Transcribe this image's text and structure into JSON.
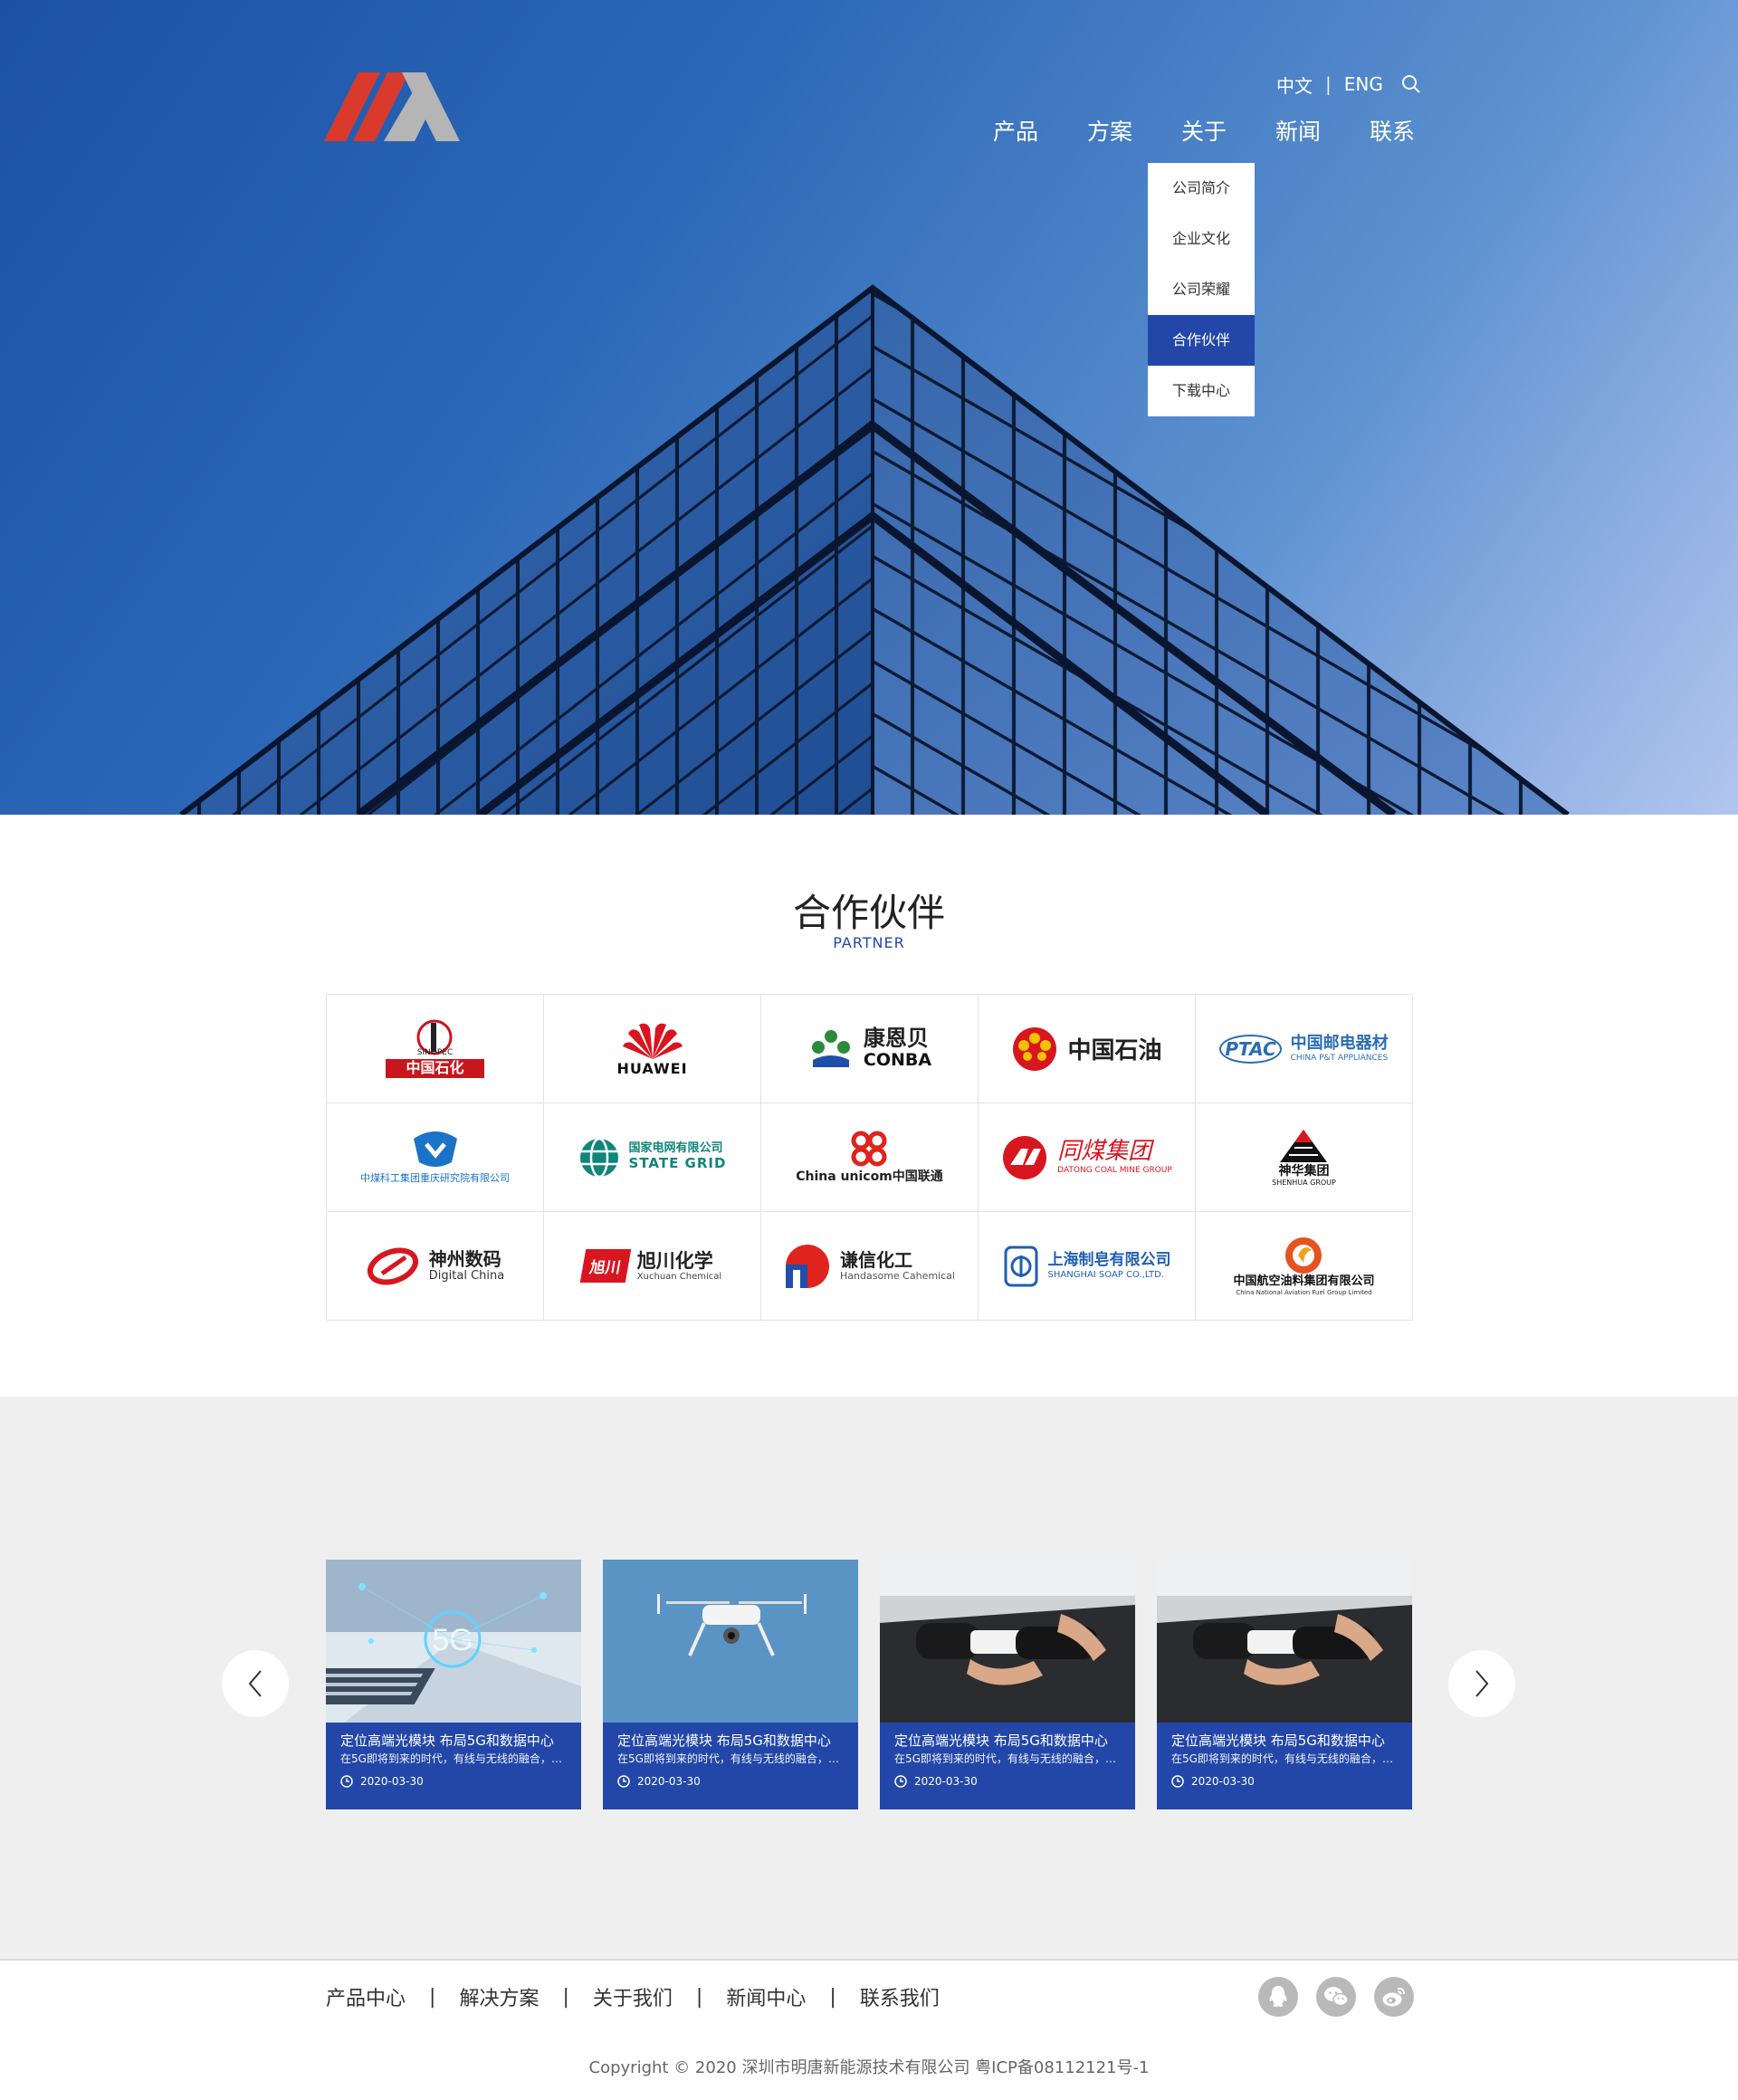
{
  "brand": {
    "accent": "#2347a9",
    "logo_red": "#d93a2b",
    "logo_gray": "#b5b5b5"
  },
  "header": {
    "lang_cn": "中文",
    "lang_sep": "|",
    "lang_en": "ENG",
    "search_icon": "search-icon",
    "nav": [
      "产品",
      "方案",
      "关于",
      "新闻",
      "联系"
    ],
    "dropdown": [
      "公司简介",
      "企业文化",
      "公司荣耀",
      "合作伙伴",
      "下载中心"
    ],
    "dropdown_active": "合作伙伴"
  },
  "partners": {
    "title": "合作伙伴",
    "subtitle": "PARTNER",
    "logos": [
      {
        "name": "中国石化",
        "en": "SINOPEC"
      },
      {
        "name": "",
        "en": "HUAWEI"
      },
      {
        "name": "康恩贝",
        "en": "CONBA"
      },
      {
        "name": "中国石油",
        "en": ""
      },
      {
        "name": "中国邮电器材",
        "en": "CHINA P&T APPLIANCES",
        "badge": "PTAC"
      },
      {
        "name": "",
        "en": "中煤科工集团重庆研究院有限公司"
      },
      {
        "name": "国家电网有限公司",
        "en": "STATE GRID"
      },
      {
        "name": "China unicom中国联通",
        "en": ""
      },
      {
        "name": "同煤集团",
        "en": "DATONG COAL MINE GROUP"
      },
      {
        "name": "神华集团",
        "en": "SHENHUA GROUP"
      },
      {
        "name": "神州数码",
        "en": "Digital China"
      },
      {
        "name": "旭川化学",
        "en": "Xuchuan Chemical",
        "badge": "旭川"
      },
      {
        "name": "谦信化工",
        "en": "Handasome Cahemical"
      },
      {
        "name": "上海制皂有限公司",
        "en": "SHANGHAI SOAP CO.,LTD."
      },
      {
        "name": "中国航空油料集团有限公司",
        "en": "China National Aviation Fuel Group Limited"
      }
    ]
  },
  "news": {
    "prev_icon": "chevron-left-icon",
    "next_icon": "chevron-right-icon",
    "cards": [
      {
        "image": "5g-network-image",
        "title": "定位高端光模块 布局5G和数据中心",
        "desc": "在5G即将到来的时代，有线与无线的融合，已...",
        "date": "2020-03-30"
      },
      {
        "image": "drone-image",
        "title": "定位高端光模块 布局5G和数据中心",
        "desc": "在5G即将到来的时代，有线与无线的融合，已...",
        "date": "2020-03-30"
      },
      {
        "image": "ev-charger-image",
        "title": "定位高端光模块 布局5G和数据中心",
        "desc": "在5G即将到来的时代，有线与无线的融合，已...",
        "date": "2020-03-30"
      },
      {
        "image": "ev-charger-image",
        "title": "定位高端光模块 布局5G和数据中心",
        "desc": "在5G即将到来的时代，有线与无线的融合，已...",
        "date": "2020-03-30"
      }
    ]
  },
  "footer": {
    "links": [
      "产品中心",
      "解决方案",
      "关于我们",
      "新闻中心",
      "联系我们"
    ],
    "sep": "|",
    "socials": [
      "qq-icon",
      "wechat-icon",
      "weibo-icon"
    ],
    "copyright": "Copyright © 2020  深圳市明唐新能源技术有限公司  粤ICP备08112121号-1"
  }
}
